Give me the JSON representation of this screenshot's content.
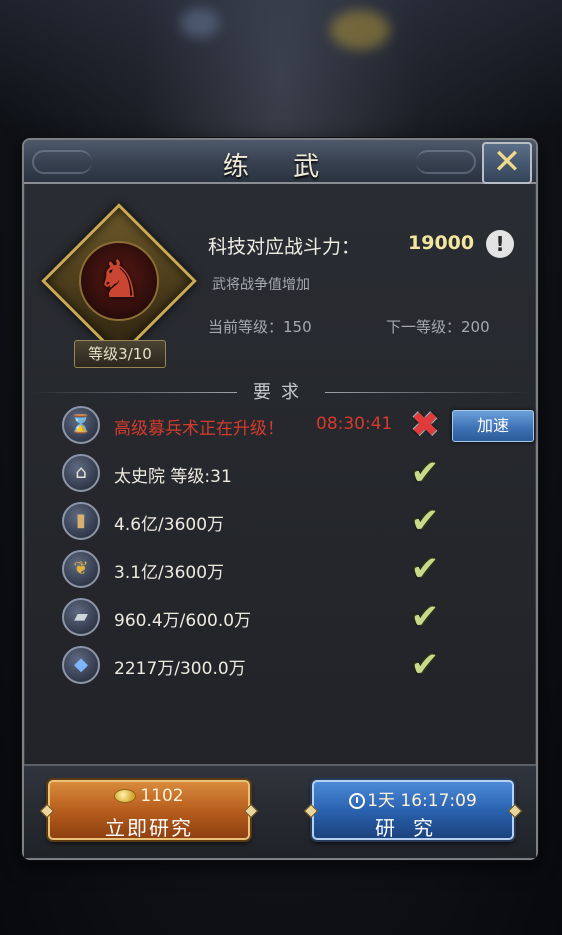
{
  "window": {
    "title": "练 武",
    "close_icon": "close-x-icon"
  },
  "tech": {
    "power_label": "科技对应战斗力：",
    "power_value": "19000",
    "info_icon": "!",
    "subtitle": "武将战争值增加",
    "current_level": "当前等级：150",
    "next_level": "下一等级：200",
    "level_badge": "等级3/10"
  },
  "requirements": {
    "title": "要求",
    "items": [
      {
        "icon": "hourglass-icon",
        "text": "高级募兵术正在升级！",
        "timer": "08:30:41",
        "status": "cross"
      },
      {
        "icon": "building-icon",
        "text": "太史院  等级:31",
        "status": "check"
      },
      {
        "icon": "wood-icon",
        "text": "4.6亿/3600万",
        "status": "check"
      },
      {
        "icon": "grain-icon",
        "text": "3.1亿/3600万",
        "status": "check"
      },
      {
        "icon": "iron-icon",
        "text": "960.4万/600.0万",
        "status": "check"
      },
      {
        "icon": "crystal-icon",
        "text": "2217万/300.0万",
        "status": "check"
      }
    ],
    "speed_button": "加速"
  },
  "buttons": {
    "instant": {
      "cost": "1102",
      "label": "立即研究",
      "icon": "coin-icon"
    },
    "research": {
      "time": "1天  16:17:09",
      "label": "研究",
      "icon": "clock-icon"
    }
  }
}
